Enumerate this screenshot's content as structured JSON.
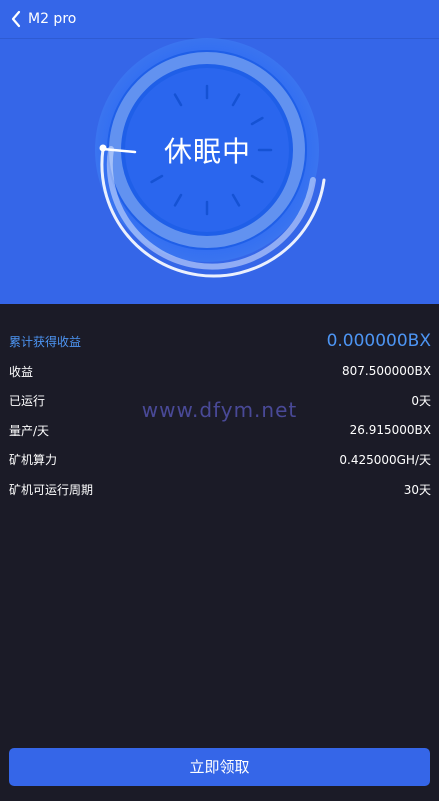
{
  "topbar": {
    "title": "M2 pro",
    "back_icon": "chevron-left-icon"
  },
  "dial": {
    "status": "休眠中",
    "progress_fraction": 0.0
  },
  "summary": {
    "total_label": "累计获得收益",
    "total_value": "0.000000BX",
    "rows": [
      {
        "label": "收益",
        "value": "807.500000BX"
      },
      {
        "label": "已运行",
        "value": "0天"
      },
      {
        "label": "量产/天",
        "value": "26.915000BX"
      },
      {
        "label": "矿机算力",
        "value": "0.425000GH/天"
      },
      {
        "label": "矿机可运行周期",
        "value": "30天"
      }
    ]
  },
  "watermark": "www.dfym.net",
  "claim_button": "立即领取",
  "colors": {
    "primary_blue": "#3566e8",
    "accent_blue": "#4d95f3",
    "background": "#1b1b27"
  }
}
